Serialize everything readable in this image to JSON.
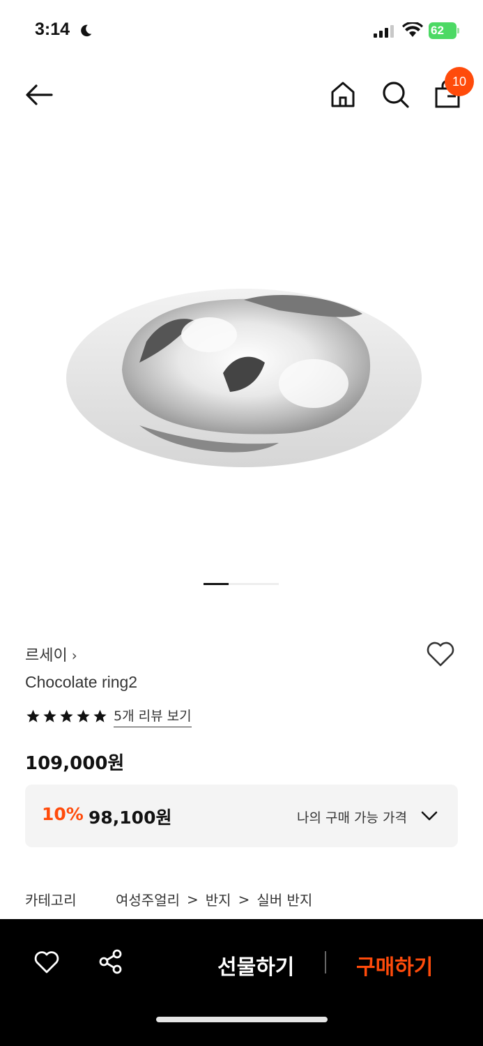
{
  "status_bar": {
    "time": "3:14",
    "battery": "62",
    "icons": [
      "moon-icon",
      "cellular-signal-icon",
      "wifi-icon",
      "battery-charging-icon"
    ]
  },
  "nav": {
    "icons": [
      "back-arrow-icon",
      "home-icon",
      "search-icon",
      "shopping-bag-icon"
    ],
    "cart_count": "10"
  },
  "gallery": {
    "page_index": 1,
    "page_total": 3
  },
  "product": {
    "brand": "르세이",
    "brand_chevron": "›",
    "name": "Chocolate ring2",
    "rating": 5,
    "review_link": "5개 리뷰 보기",
    "price": "109,000원",
    "discount_rate": "10%",
    "discount_price": "98,100원",
    "my_price_label": "나의 구매 가능 가격"
  },
  "category": {
    "label": "카테고리",
    "path": [
      "여성주얼리",
      "반지",
      "실버 반지"
    ],
    "separator": ">"
  },
  "bottom_bar": {
    "gift_label": "선물하기",
    "buy_label": "구매하기"
  },
  "colors": {
    "accent": "#ff4b0b",
    "bottom_bar_bg": "#000000",
    "battery": "#4cd964"
  }
}
